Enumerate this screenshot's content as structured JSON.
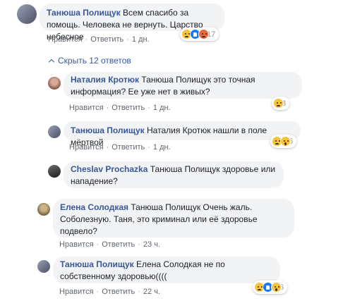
{
  "comments": [
    {
      "author": "Танюша Полищук",
      "text": "Всем спасибо за помощь. Человека не вернуть. Царство небесное",
      "actions": {
        "like": "Нравится",
        "reply": "Ответить",
        "time": "1 дн."
      },
      "reactions": {
        "icons": [
          "sad-icon",
          "like-icon",
          "angry-icon"
        ],
        "count": "17"
      }
    },
    {
      "author": "Наталия Кротюк",
      "text": "Танюша Полищук это точная информация? Ее уже нет в живых?",
      "actions": {
        "like": "Нравится",
        "reply": "Ответить",
        "time": "1 дн."
      },
      "reactions": {
        "icons": [
          "sad-icon"
        ],
        "count": "3"
      }
    },
    {
      "author": "Танюша Полищук",
      "text": "Наталия Кротюк нашли в поле мёртвой",
      "actions": {
        "like": "Нравится",
        "reply": "Ответить",
        "time": "1 дн."
      },
      "reactions": {
        "icons": [
          "sad-icon",
          "wow-icon"
        ],
        "count": "6"
      }
    },
    {
      "author": "Cheslav Prochazka",
      "text": "Танюша Полищук здоровье или нападение?",
      "actions": null,
      "reactions": null
    },
    {
      "author": "Елена Солодкая",
      "text": "Танюша Полищук Очень жаль. Соболезную. Таня, это криминал или её здоровье подвело?",
      "actions": {
        "like": "Нравится",
        "reply": "Ответить",
        "time": "23 ч."
      },
      "reactions": null
    },
    {
      "author": "Танюша Полищук",
      "text": "Елена Солодкая не по собственному здоровью((((",
      "actions": {
        "like": "Нравится",
        "reply": "Ответить",
        "time": "22 ч."
      },
      "reactions": {
        "icons": [
          "sad-icon",
          "like-icon",
          "wow-icon"
        ],
        "count": "6"
      }
    }
  ],
  "hide_replies": "Скрыть 12 ответов",
  "dot": "·"
}
